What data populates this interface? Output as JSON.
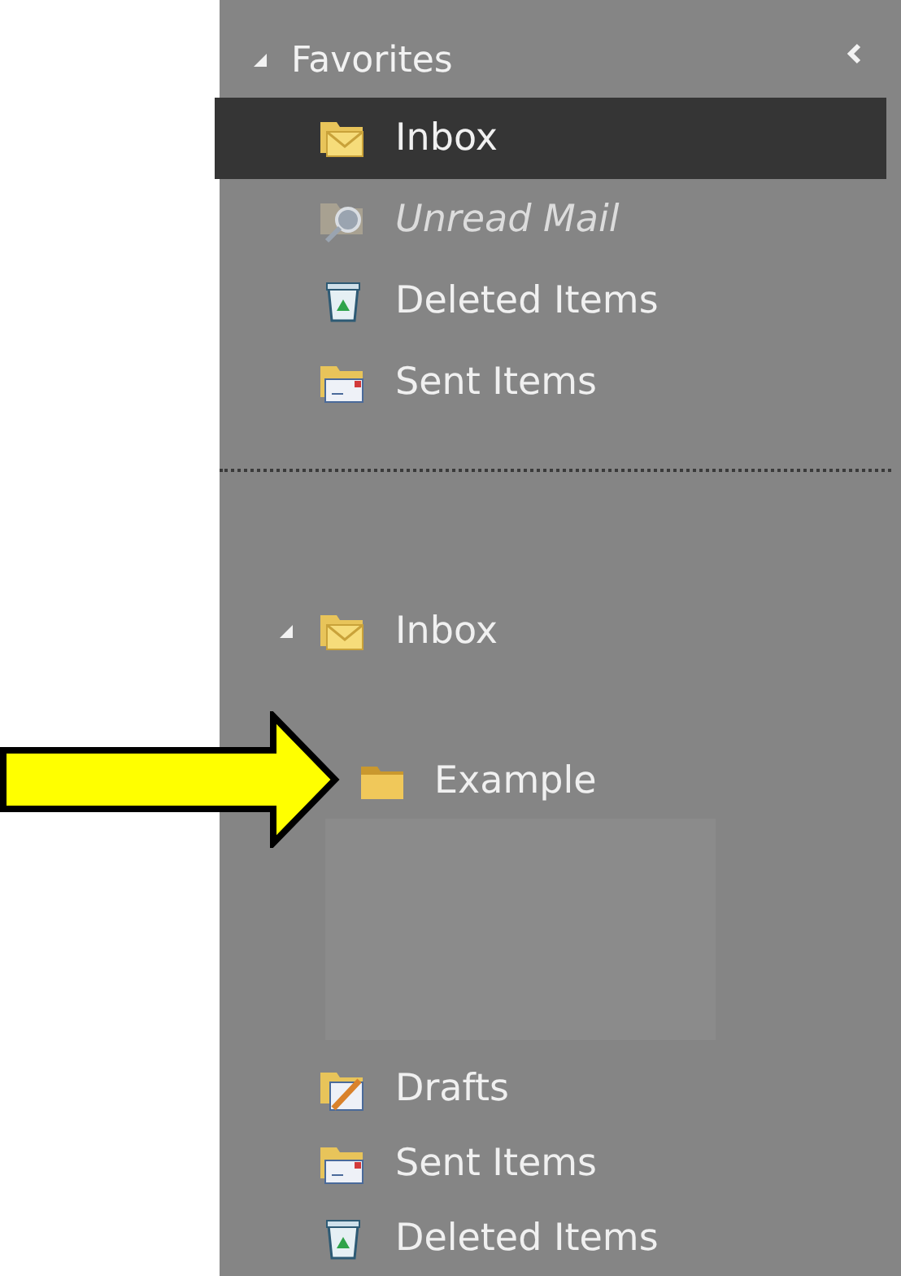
{
  "favorites": {
    "title": "Favorites",
    "expanded": true,
    "items": [
      {
        "label": "Inbox",
        "kind": "inbox",
        "selected": true
      },
      {
        "label": "Unread Mail",
        "kind": "search",
        "selected": false
      },
      {
        "label": "Deleted Items",
        "kind": "deleted",
        "selected": false
      },
      {
        "label": "Sent Items",
        "kind": "sent",
        "selected": false
      }
    ]
  },
  "mailbox": {
    "items": [
      {
        "label": "Inbox",
        "kind": "inbox",
        "selected": false,
        "expanded": true,
        "children": [
          {
            "label": "Example",
            "kind": "folder",
            "selected": false,
            "arrow": true
          }
        ]
      },
      {
        "label": "Drafts",
        "kind": "drafts",
        "selected": false
      },
      {
        "label": "Sent Items",
        "kind": "sent",
        "selected": false
      },
      {
        "label": "Deleted Items",
        "kind": "deleted",
        "selected": false
      }
    ]
  }
}
